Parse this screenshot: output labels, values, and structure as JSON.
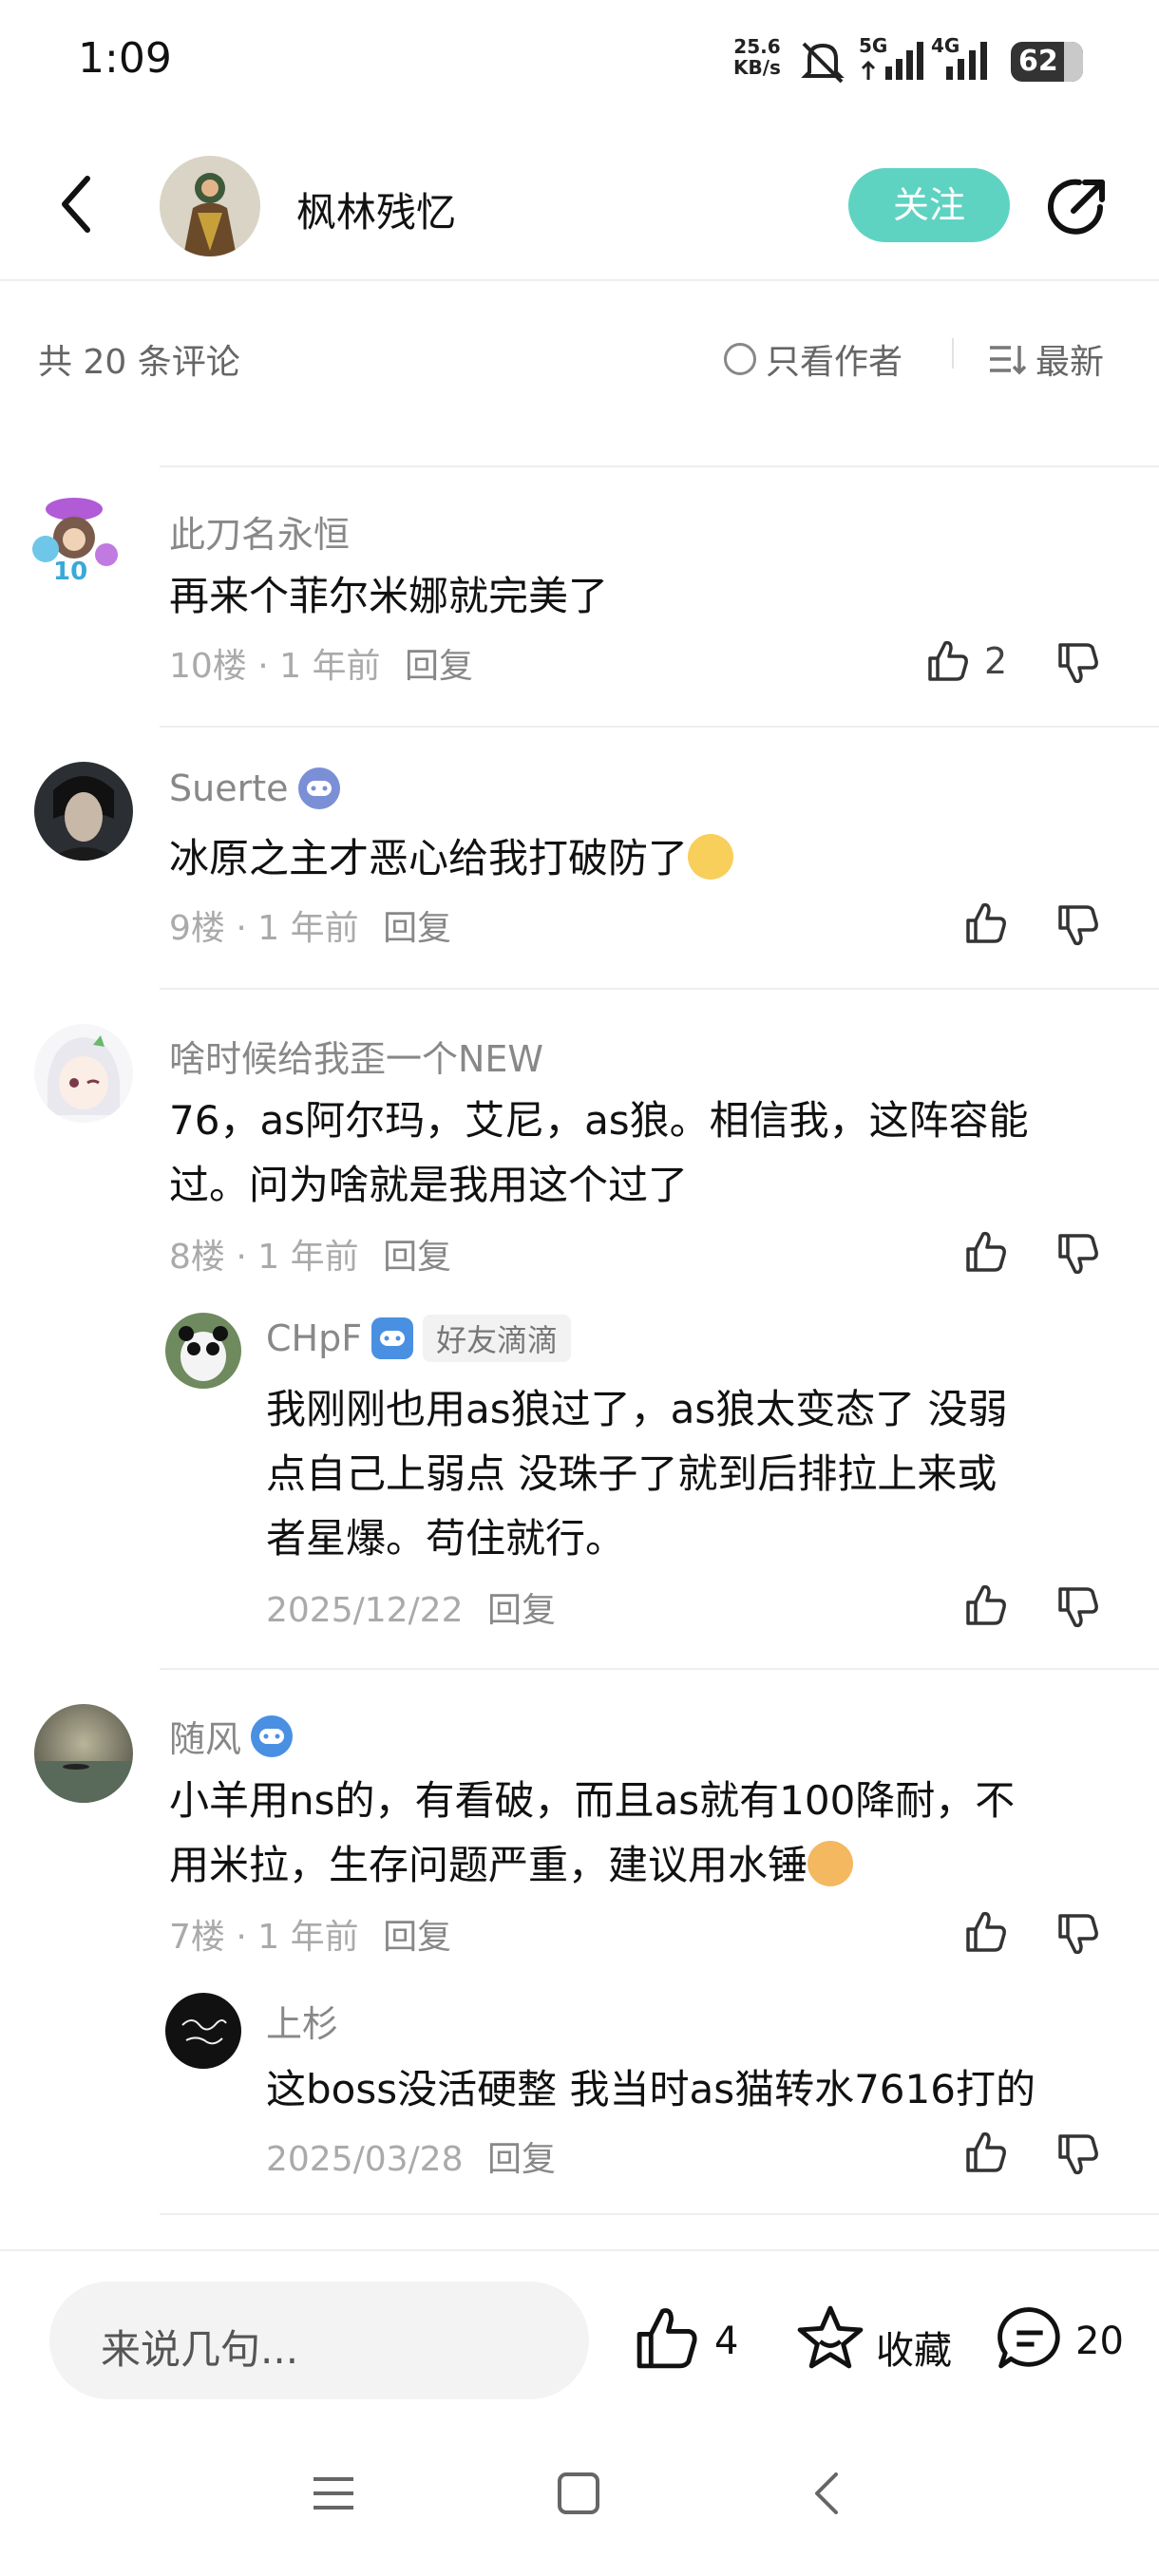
{
  "status_bar": {
    "time": "1:09",
    "speed_value": "25.6",
    "speed_unit": "KB/s",
    "net1": "5G",
    "net2": "4G",
    "battery": "62"
  },
  "header": {
    "title": "枫林残忆",
    "follow_label": "关注"
  },
  "filter_bar": {
    "count_text": "共 20 条评论",
    "author_only_label": "只看作者",
    "sort_label": "最新"
  },
  "comments": [
    {
      "user": "此刀名永恒",
      "text": "再来个菲尔米娜就完美了",
      "floor": "10楼",
      "time": "1 年前",
      "reply_label": "回复",
      "likes": "2"
    },
    {
      "user": "Suerte",
      "text": "冰原之主才恶心给我打破防了",
      "floor": "9楼",
      "time": "1 年前",
      "reply_label": "回复"
    },
    {
      "user": "啥时候给我歪一个NEW",
      "text_line1": "76，as阿尔玛，艾尼，as狼。相信我，这阵容能",
      "text_line2": "过。问为啥就是我用这个过了",
      "floor": "8楼",
      "time": "1 年前",
      "reply_label": "回复",
      "reply": {
        "user": "CHpF",
        "tag": "好友滴滴",
        "text_line1": "我刚刚也用as狼过了，as狼太变态了 没弱",
        "text_line2": "点自己上弱点  没珠子了就到后排拉上来或",
        "text_line3": "者星爆。苟住就行。",
        "date": "2025/12/22",
        "reply_label": "回复"
      }
    },
    {
      "user": "随风",
      "text_line1": "小羊用ns的，有看破，而且as就有100降耐，不",
      "text_line2": "用米拉，生存问题严重，建议用水锤",
      "floor": "7楼",
      "time": "1 年前",
      "reply_label": "回复",
      "reply": {
        "user": "上杉",
        "text": "这boss没活硬整 我当时as猫转水7616打的",
        "date": "2025/03/28",
        "reply_label": "回复"
      }
    }
  ],
  "bottom_bar": {
    "input_placeholder": "来说几句...",
    "like_count": "4",
    "favorite_label": "收藏",
    "comment_count": "20"
  },
  "colors": {
    "accent": "#5ed3c2",
    "badge_blue": "#4a90e2",
    "badge_purple": "#7b8fd6"
  }
}
